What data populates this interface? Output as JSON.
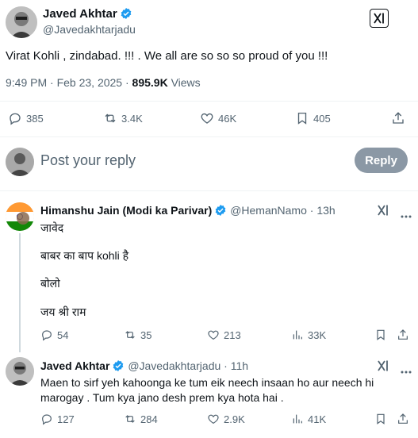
{
  "main_tweet": {
    "author_name": "Javed Akhtar",
    "handle": "@Javedakhtarjadu",
    "text": "Virat Kohli , zindabad. !!! . We all are so so so proud of you !!!",
    "timestamp": "9:49 PM · Feb 23, 2025 · ",
    "views_count": "895.9K",
    "views_label": "Views",
    "stats": {
      "replies": "385",
      "reposts": "3.4K",
      "likes": "46K",
      "bookmarks": "405"
    }
  },
  "composer": {
    "placeholder": "Post your reply",
    "reply_button": "Reply"
  },
  "replies": [
    {
      "author_name": "Himanshu Jain (Modi ka Parivar)",
      "handle": "@HemanNamo",
      "time": "· 13h",
      "lines": [
        "जावेद",
        "बाबर का बाप kohli है",
        "बोलो",
        "जय श्री राम"
      ],
      "stats": {
        "replies": "54",
        "reposts": "35",
        "likes": "213",
        "views": "33K"
      }
    },
    {
      "author_name": "Javed Akhtar",
      "handle": "@Javedakhtarjadu",
      "time": "· 11h",
      "lines": [
        "Maen to sirf yeh kahoonga ke tum eik neech insaan ho aur neech hi",
        "marogay . Tum kya jano desh prem kya hota hai ."
      ],
      "stats": {
        "replies": "127",
        "reposts": "284",
        "likes": "2.9K",
        "views": "41K"
      }
    }
  ],
  "icons": {
    "verified": "verified-badge-icon",
    "grok": "grok-icon",
    "reply": "reply-icon",
    "repost": "repost-icon",
    "like": "like-icon",
    "bookmark": "bookmark-icon",
    "share": "share-icon",
    "views": "views-icon"
  },
  "colors": {
    "verified_blue": "#1d9bf0",
    "muted_text": "#536471",
    "reply_button_bg": "#8b98a5"
  }
}
